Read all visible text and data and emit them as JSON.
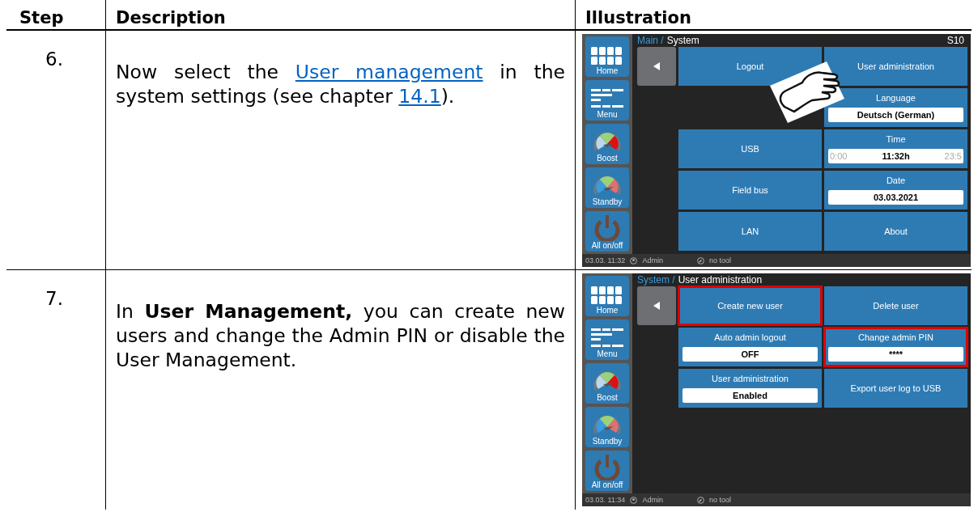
{
  "columns": [
    "Step",
    "Description",
    "Illustration"
  ],
  "rows": [
    {
      "step": "6.",
      "description": [
        {
          "kind": "text",
          "text": "Now select the "
        },
        {
          "kind": "link",
          "text": "User management"
        },
        {
          "kind": "text",
          "text": " in the system settings (see chapter "
        },
        {
          "kind": "link",
          "text": "14.1"
        },
        {
          "kind": "text",
          "text": ")."
        }
      ],
      "screen": {
        "path_parent": "Main /",
        "path_current": "System",
        "code": "S10",
        "pointer": true,
        "sidebar": [
          {
            "kind": "home",
            "label": "Home"
          },
          {
            "kind": "menu",
            "label": "Menu"
          },
          {
            "kind": "boost",
            "label": "Boost"
          },
          {
            "kind": "standby",
            "label": "Standby"
          },
          {
            "kind": "power",
            "label": "All on/off"
          }
        ],
        "tile_rows": [
          {
            "left": {
              "kind": "button",
              "label": "Logout",
              "highlighted": false
            },
            "right": {
              "kind": "button",
              "label": "User administration",
              "highlighted": false
            }
          },
          {
            "right": {
              "kind": "field",
              "label": "Language",
              "value": "Deutsch (German)",
              "highlighted": false
            }
          },
          {
            "left": {
              "kind": "button",
              "label": "USB",
              "highlighted": false
            },
            "right": {
              "kind": "range",
              "label": "Time",
              "min": "0:00",
              "value": "11:32h",
              "max": "23:5",
              "highlighted": false
            }
          },
          {
            "left": {
              "kind": "button",
              "label": "Field bus",
              "highlighted": false
            },
            "right": {
              "kind": "field",
              "label": "Date",
              "value": "03.03.2021",
              "highlighted": false
            }
          },
          {
            "left": {
              "kind": "button",
              "label": "LAN",
              "highlighted": false
            },
            "right": {
              "kind": "button",
              "label": "About",
              "highlighted": false
            }
          }
        ],
        "status": {
          "datetime": "03.03. 11:32",
          "user": "Admin",
          "tool": "no tool"
        }
      }
    },
    {
      "step": "7.",
      "description": [
        {
          "kind": "text",
          "text": "In **User Management,** you can create new users and change the Admin PIN or disable the User Management."
        }
      ],
      "screen": {
        "path_parent": "System /",
        "path_current": "User administration",
        "pointer": false,
        "sidebar": [
          {
            "kind": "home",
            "label": "Home"
          },
          {
            "kind": "menu",
            "label": "Menu"
          },
          {
            "kind": "boost",
            "label": "Boost"
          },
          {
            "kind": "standby",
            "label": "Standby"
          },
          {
            "kind": "power",
            "label": "All on/off"
          }
        ],
        "tile_rows": [
          {
            "left": {
              "kind": "button",
              "label": "Create new user",
              "highlighted": true
            },
            "right": {
              "kind": "button",
              "label": "Delete user",
              "highlighted": false
            }
          },
          {
            "left": {
              "kind": "field",
              "label": "Auto admin logout",
              "value": "OFF",
              "highlighted": false
            },
            "right": {
              "kind": "field",
              "label": "Change admin PIN",
              "value": "****",
              "highlighted": true
            }
          },
          {
            "left": {
              "kind": "field",
              "label": "User administration",
              "value": "Enabled",
              "highlighted": false
            },
            "right": {
              "kind": "button",
              "label": "Export user log to USB",
              "highlighted": false
            }
          }
        ],
        "status": {
          "datetime": "03.03. 11:34",
          "user": "Admin",
          "tool": "no tool"
        }
      }
    }
  ]
}
